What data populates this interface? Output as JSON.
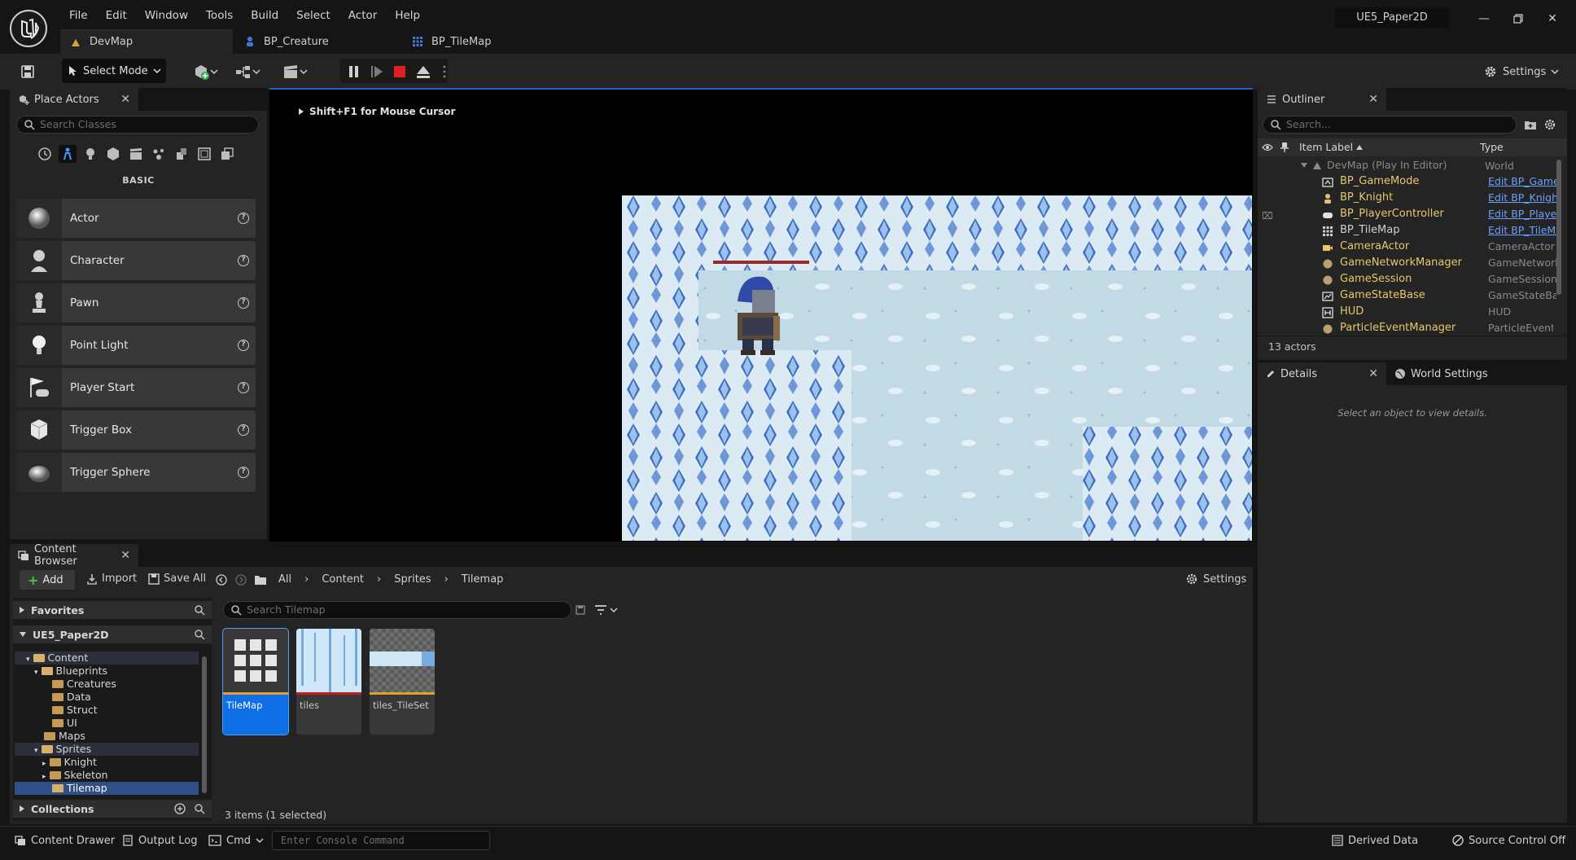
{
  "menu": [
    "File",
    "Edit",
    "Window",
    "Tools",
    "Build",
    "Select",
    "Actor",
    "Help"
  ],
  "project_name": "UE5_Paper2D",
  "doc_tabs": [
    {
      "label": "DevMap",
      "icon": "level-icon"
    },
    {
      "label": "BP_Creature",
      "icon": "blueprint-icon"
    },
    {
      "label": "BP_TileMap",
      "icon": "tilemap-icon"
    }
  ],
  "toolbar": {
    "select_mode": "Select Mode",
    "settings": "Settings"
  },
  "place_actors": {
    "tab": "Place Actors",
    "search_placeholder": "Search Classes",
    "category": "BASIC",
    "items": [
      "Actor",
      "Character",
      "Pawn",
      "Point Light",
      "Player Start",
      "Trigger Box",
      "Trigger Sphere"
    ]
  },
  "viewport": {
    "hint": "Shift+F1 for Mouse Cursor"
  },
  "outliner": {
    "tab": "Outliner",
    "search_placeholder": "Search...",
    "col_label": "Item Label",
    "col_type": "Type",
    "root": {
      "name": "DevMap (Play In Editor)",
      "type": "World"
    },
    "rows": [
      {
        "name": "BP_GameMode",
        "type": "Edit BP_GameMode",
        "icon": "gamemode-icon"
      },
      {
        "name": "BP_Knight",
        "type": "Edit BP_Knight",
        "icon": "character-icon"
      },
      {
        "name": "BP_PlayerController",
        "type": "Edit BP_PlayerController",
        "icon": "controller-icon"
      },
      {
        "name": "BP_TileMap",
        "type": "Edit BP_TileMap",
        "icon": "tilemap-icon"
      },
      {
        "name": "CameraActor",
        "type": "CameraActor",
        "icon": "camera-icon"
      },
      {
        "name": "GameNetworkManager",
        "type": "GameNetworkManager",
        "icon": "actor-icon"
      },
      {
        "name": "GameSession",
        "type": "GameSession",
        "icon": "actor-icon"
      },
      {
        "name": "GameStateBase",
        "type": "GameStateBase",
        "icon": "gamestate-icon"
      },
      {
        "name": "HUD",
        "type": "HUD",
        "icon": "hud-icon"
      },
      {
        "name": "ParticleEventManager",
        "type": "ParticleEventManager",
        "icon": "actor-icon"
      }
    ],
    "count": "13 actors"
  },
  "details": {
    "tab": "Details",
    "tab2": "World Settings",
    "empty": "Select an object to view details."
  },
  "content_browser": {
    "tab": "Content Browser",
    "add": "Add",
    "import": "Import",
    "save_all": "Save All",
    "breadcrumb": [
      "All",
      "Content",
      "Sprites",
      "Tilemap"
    ],
    "settings": "Settings",
    "favorites": "Favorites",
    "project": "UE5_Paper2D",
    "tree": [
      "Content",
      "Blueprints",
      "Creatures",
      "Data",
      "Struct",
      "UI",
      "Maps",
      "Sprites",
      "Knight",
      "Skeleton",
      "Tilemap"
    ],
    "collections": "Collections",
    "search_placeholder": "Search Tilemap",
    "assets": [
      "TileMap",
      "tiles",
      "tiles_TileSet"
    ],
    "item_count": "3 items (1 selected)"
  },
  "statusbar": {
    "content_drawer": "Content Drawer",
    "output_log": "Output Log",
    "cmd": "Cmd",
    "console_placeholder": "Enter Console Command",
    "derived_data": "Derived Data",
    "source_control": "Source Control Off"
  },
  "colors": {
    "accent": "#0f6fe6",
    "panel": "#242424",
    "background": "#151515",
    "link": "#6aa0ff",
    "stop": "#e02020"
  }
}
